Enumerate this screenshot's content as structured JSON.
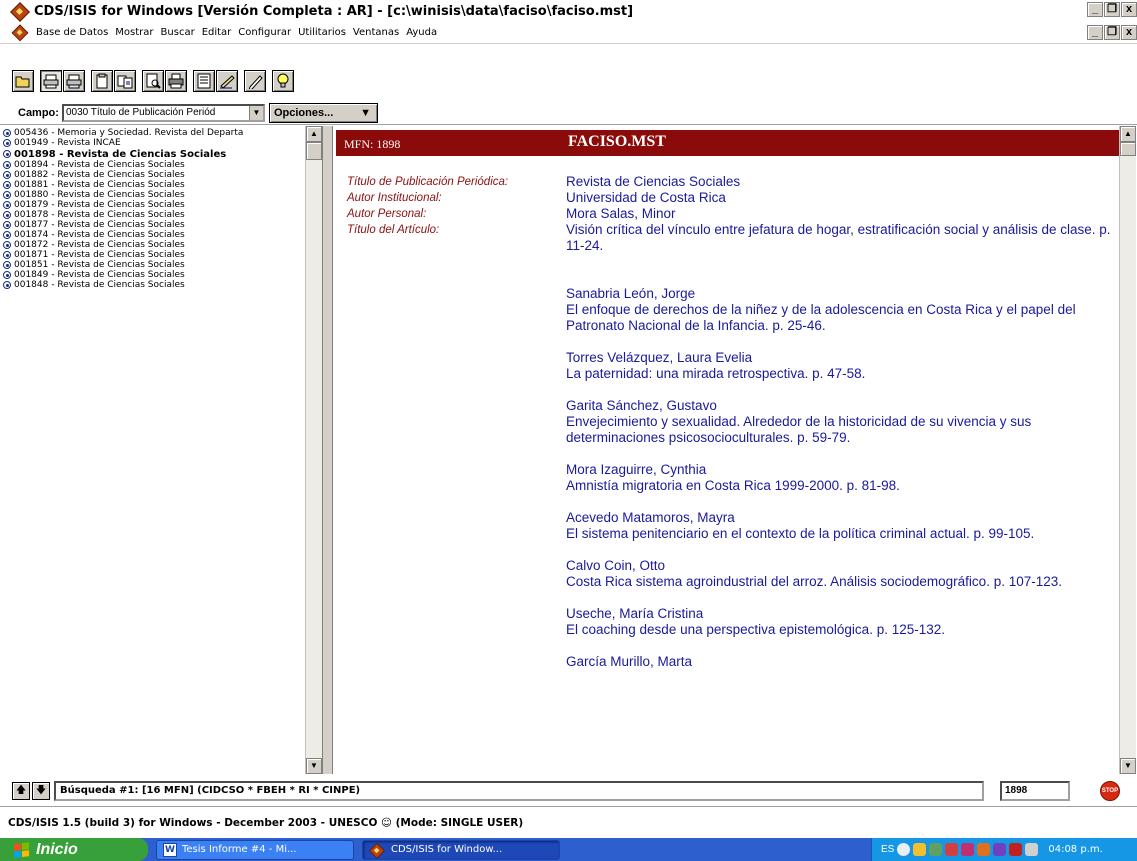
{
  "window": {
    "title": "CDS/ISIS for Windows [Versión Completa : AR] - [c:\\winisis\\data\\faciso\\faciso.mst]",
    "min_glyph": "_",
    "restore_glyph": "๛",
    "close_glyph": "x"
  },
  "menu": {
    "items": [
      "Base de Datos",
      "Mostrar",
      "Buscar",
      "Editar",
      "Configurar",
      "Utilitarios",
      "Ventanas",
      "Ayuda"
    ]
  },
  "toolbar": {
    "buttons": [
      "open-icon",
      "print-txt-icon",
      "print-rtf-icon",
      "clipboard-icon",
      "copy-icon",
      "preview-icon",
      "printer-icon",
      "form-icon",
      "edit-icon",
      "pencil-icon",
      "bulb-icon"
    ]
  },
  "campo": {
    "label": "Campo:",
    "value": "0030 Título de Publicación Periód",
    "opciones": "Opciones..."
  },
  "list": {
    "items": [
      "005436 - Memoria y Sociedad. Revista del Departa",
      "001949 - Revista INCAE",
      "001898 - Revista de Ciencias Sociales",
      "001894 - Revista de Ciencias Sociales",
      "001882 - Revista de Ciencias Sociales",
      "001881 - Revista de Ciencias Sociales",
      "001880 - Revista de Ciencias Sociales",
      "001879 - Revista de Ciencias Sociales",
      "001878 - Revista de Ciencias Sociales",
      "001877 - Revista de Ciencias Sociales",
      "001874 - Revista de Ciencias Sociales",
      "001872 - Revista de Ciencias Sociales",
      "001871 - Revista de Ciencias Sociales",
      "001851 - Revista de Ciencias Sociales",
      "001849 - Revista de Ciencias Sociales",
      "001848 - Revista de Ciencias Sociales"
    ],
    "selected_index": 2
  },
  "record": {
    "mfn_label": "MFN: 1898",
    "db_label": "FACISO.MST",
    "fields": [
      {
        "label": "Título de Publicación Periódica:",
        "value": "Revista de Ciencias Sociales"
      },
      {
        "label": "Autor Institucional:",
        "value": "Universidad de Costa Rica"
      },
      {
        "label": "Autor Personal:",
        "value": "Mora Salas, Minor"
      },
      {
        "label": "Título del Artículo:",
        "value": "Visión crítica del vínculo entre jefatura de hogar, estratificación social y análisis de clase. p. 11-24."
      }
    ],
    "articles": [
      {
        "author": "Sanabria León, Jorge",
        "title": "El enfoque de derechos de la niñez y de la adolescencia en Costa Rica y el papel del Patronato Nacional de la Infancia. p. 25-46."
      },
      {
        "author": "Torres Velázquez, Laura Evelia",
        "title": "La paternidad: una mirada retrospectiva. p. 47-58."
      },
      {
        "author": "Garita Sánchez, Gustavo",
        "title": "Envejecimiento y sexualidad. Alrededor de la historicidad de su vivencia y sus determinaciones psicosocioculturales. p. 59-79."
      },
      {
        "author": "Mora Izaguirre, Cynthia",
        "title": "Amnistía migratoria en Costa Rica 1999-2000. p. 81-98."
      },
      {
        "author": "Acevedo Matamoros, Mayra",
        "title": "El sistema penitenciario en el contexto de la política criminal actual. p. 99-105."
      },
      {
        "author": "Calvo Coin, Otto",
        "title": "Costa Rica sistema agroindustrial del arroz. Análisis sociodemográfico. p. 107-123."
      },
      {
        "author": "Useche, María Cristina",
        "title": "El coaching desde una perspectiva epistemológica. p. 125-132."
      },
      {
        "author": "García Murillo, Marta",
        "title": ""
      }
    ]
  },
  "status": {
    "search": "Búsqueda #1: [16 MFN] (CIDCSO * FBEH * RI * CINPE)",
    "mfn": "1898",
    "stop": "STOP",
    "footer": "CDS/ISIS 1.5 (build 3) for Windows - December 2003 - UNESCO ☺ (Mode: SINGLE USER)"
  },
  "taskbar": {
    "start": "Inicio",
    "tasks": [
      "Tesis Informe #4 - Mi...",
      "CDS/ISIS for Window..."
    ],
    "lang": "ES",
    "clock": "04:08 p.m."
  },
  "colors": {
    "record_header_bg": "#8b0a0a",
    "field_label": "#8b1010",
    "field_value": "#1a1a9a",
    "taskbar": "#2e5fcf",
    "start": "#37a03a"
  }
}
